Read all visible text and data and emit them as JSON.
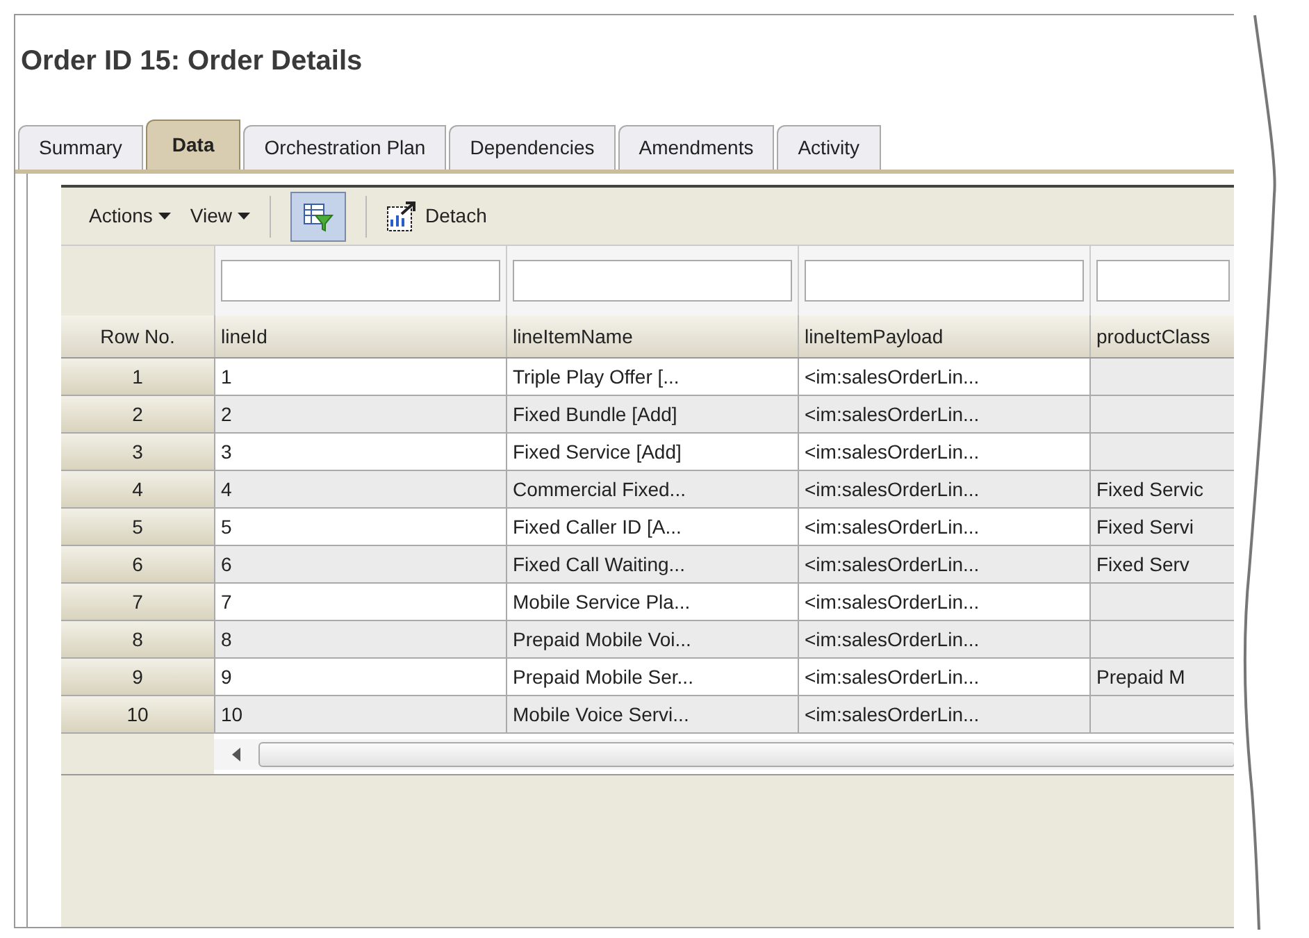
{
  "title": "Order ID 15: Order Details",
  "tabs": [
    {
      "label": "Summary",
      "selected": false
    },
    {
      "label": "Data",
      "selected": true
    },
    {
      "label": "Orchestration Plan",
      "selected": false
    },
    {
      "label": "Dependencies",
      "selected": false
    },
    {
      "label": "Amendments",
      "selected": false
    },
    {
      "label": "Activity",
      "selected": false
    }
  ],
  "toolbar": {
    "menus": [
      "Actions",
      "View"
    ],
    "detach": "Detach"
  },
  "table": {
    "row_number_header": "Row No.",
    "columns": [
      "lineId",
      "lineItemName",
      "lineItemPayload",
      "productClass"
    ],
    "rows": [
      {
        "row_no": "1",
        "cells": [
          "1",
          "Triple Play Offer [...",
          "<im:salesOrderLin..."
        ]
      },
      {
        "row_no": "2",
        "cells": [
          "2",
          "Fixed Bundle [Add]",
          "<im:salesOrderLin..."
        ]
      },
      {
        "row_no": "3",
        "cells": [
          "3",
          "Fixed Service [Add]",
          "<im:salesOrderLin..."
        ]
      },
      {
        "row_no": "4",
        "cells": [
          "4",
          "Commercial Fixed...",
          "<im:salesOrderLin...",
          "Fixed Servic"
        ]
      },
      {
        "row_no": "5",
        "cells": [
          "5",
          "Fixed Caller ID [A...",
          "<im:salesOrderLin...",
          "Fixed Servi"
        ]
      },
      {
        "row_no": "6",
        "cells": [
          "6",
          "Fixed Call Waiting...",
          "<im:salesOrderLin...",
          "Fixed Serv"
        ]
      },
      {
        "row_no": "7",
        "cells": [
          "7",
          "Mobile Service Pla...",
          "<im:salesOrderLin..."
        ]
      },
      {
        "row_no": "8",
        "cells": [
          "8",
          "Prepaid Mobile Voi...",
          "<im:salesOrderLin..."
        ]
      },
      {
        "row_no": "9",
        "cells": [
          "9",
          "Prepaid Mobile Ser...",
          "<im:salesOrderLin...",
          "Prepaid M"
        ]
      },
      {
        "row_no": "10",
        "cells": [
          "10",
          "Mobile Voice Servi...",
          "<im:salesOrderLin..."
        ]
      }
    ]
  }
}
